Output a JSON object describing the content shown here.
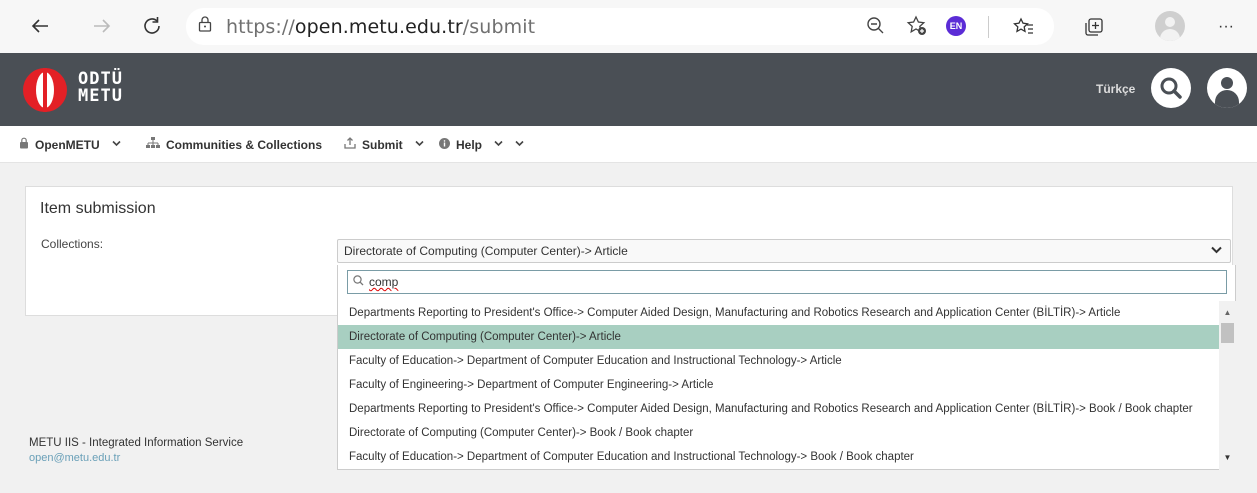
{
  "browser": {
    "url_scheme": "https://",
    "url_host": "open.metu.edu.tr",
    "url_path": "/submit",
    "language_badge": "EN",
    "more": "···"
  },
  "header": {
    "logo_line1": "ODTÜ",
    "logo_line2": "METU",
    "language_link": "Türkçe"
  },
  "nav": {
    "items": [
      {
        "label": "OpenMETU",
        "icon": "lock-icon"
      },
      {
        "label": "Communities & Collections",
        "icon": "sitemap-icon"
      },
      {
        "label": "Submit",
        "icon": "upload-icon"
      },
      {
        "label": "Help",
        "icon": "info-circle-icon"
      }
    ]
  },
  "form": {
    "title": "Item submission",
    "collections_label": "Collections:",
    "selected_collection": "Directorate of Computing (Computer Center)-> Article"
  },
  "dropdown": {
    "search_value": "comp",
    "options": [
      "Departments Reporting to President's Office-> Computer Aided Design, Manufacturing and Robotics Research and Application Center (BİLTİR)-> Article",
      "Directorate of Computing (Computer Center)-> Article",
      "Faculty of Education-> Department of Computer Education and Instructional Technology-> Article",
      "Faculty of Engineering-> Department of Computer Engineering-> Article",
      "Departments Reporting to President's Office-> Computer Aided Design, Manufacturing and Robotics Research and Application Center (BİLTİR)-> Book / Book chapter",
      "Directorate of Computing (Computer Center)-> Book / Book chapter",
      "Faculty of Education-> Department of Computer Education and Instructional Technology-> Book / Book chapter"
    ],
    "selected_index": 1
  },
  "footer": {
    "title": "METU IIS - Integrated Information Service",
    "email": "open@metu.edu.tr"
  },
  "colors": {
    "header_bg": "#4a4f55",
    "selected_option_bg": "#a8cfc1",
    "logo_red": "#e32026",
    "link_blue": "#6aa0b8"
  }
}
